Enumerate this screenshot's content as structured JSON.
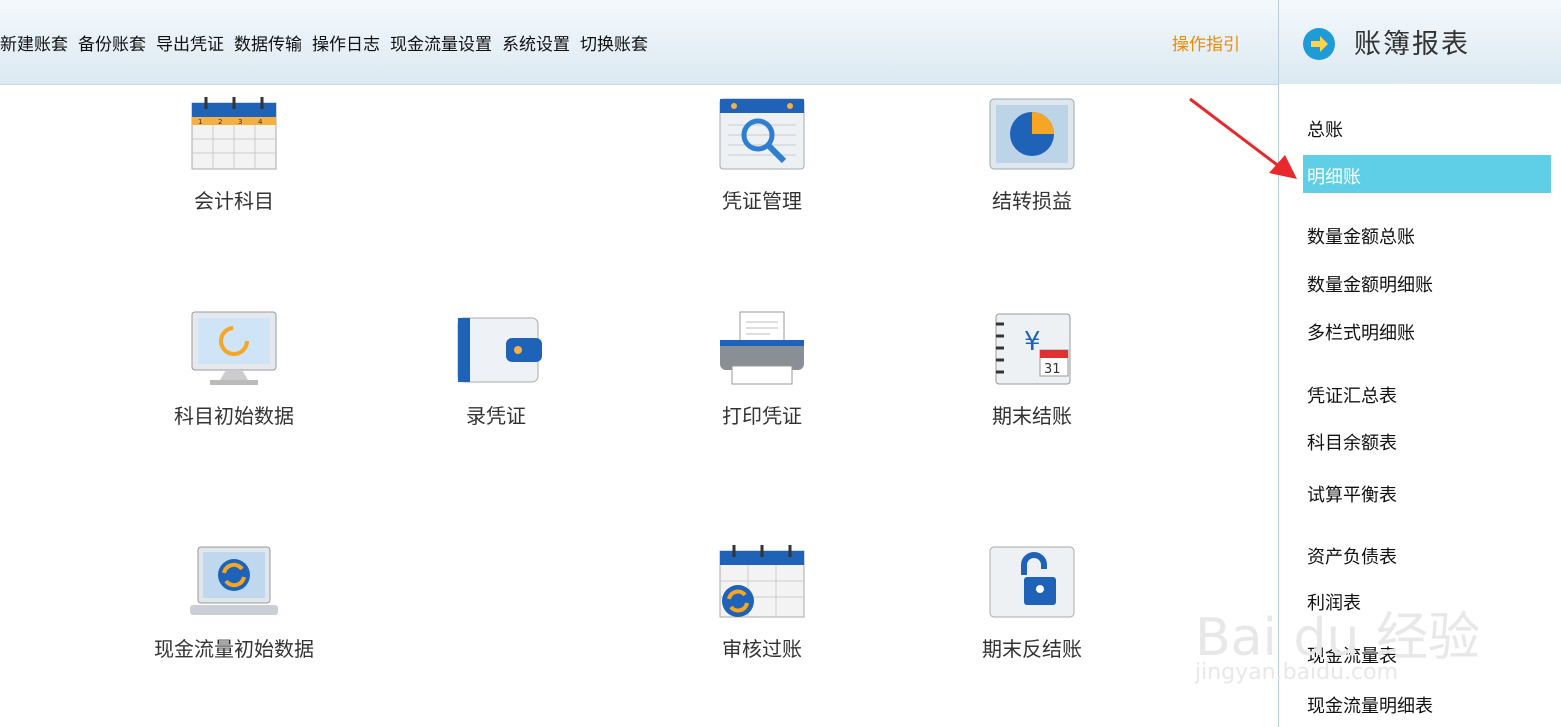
{
  "toolbar": {
    "menu_items": [
      "新建账套",
      "备份账套",
      "导出凭证",
      "数据传输",
      "操作日志",
      "现金流量设置",
      "系统设置",
      "切换账套"
    ],
    "guide": "操作指引"
  },
  "sidebar": {
    "title": "账簿报表",
    "items": [
      "总账",
      "明细账",
      "数量金额总账",
      "数量金额明细账",
      "多栏式明细账",
      "凭证汇总表",
      "科目余额表",
      "试算平衡表",
      "资产负债表",
      "利润表",
      "现金流量表",
      "现金流量明细表"
    ],
    "selected": "明细账"
  },
  "tiles": {
    "t1": "会计科目",
    "t2": "凭证管理",
    "t3": "结转损益",
    "t4": "科目初始数据",
    "t5": "录凭证",
    "t6": "打印凭证",
    "t7": "期末结账",
    "t8": "现金流量初始数据",
    "t9": "审核过账",
    "t10": "期末反结账"
  },
  "icons": {
    "calendar_day_1": "1",
    "calendar_day_2": "2",
    "calendar_day_3": "3",
    "calendar_day_4": "4",
    "ledger_currency": "¥",
    "ledger_day": "31"
  },
  "watermark": {
    "brand": "Bai du 经验",
    "url": "jingyan.baidu.com"
  },
  "colors": {
    "accent": "#1f9bd8",
    "highlight": "#5fcfe7",
    "guide": "#f08a00"
  }
}
